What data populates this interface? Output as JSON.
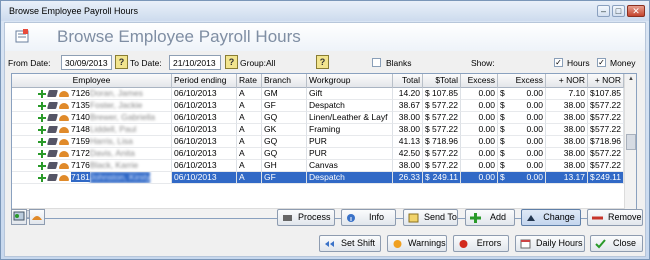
{
  "window": {
    "title": "Browse Employee Payroll Hours",
    "min": "–",
    "max": "□",
    "close": "✕"
  },
  "header": {
    "title": "Browse Employee Payroll Hours"
  },
  "filters": {
    "from_label": "From Date:",
    "from_value": "30/09/2013",
    "to_label": "To Date:",
    "to_value": "21/10/2013",
    "group_label": "Group:All",
    "blanks_label": "Blanks",
    "blanks_checked": false,
    "show_label": "Show:",
    "hours_label": "Hours",
    "hours_checked": true,
    "money_label": "Money",
    "money_checked": true,
    "help": "?"
  },
  "grid": {
    "columns": [
      "Employee",
      "Period ending",
      "Rate",
      "Branch",
      "Workgroup",
      "Total",
      "$Total",
      "Excess",
      "Excess",
      "+ NOR",
      "+ NOR"
    ],
    "rows": [
      {
        "id": "7126",
        "name": "Doran, James",
        "period": "06/10/2013",
        "rate": "A",
        "branch": "GM",
        "workgroup": "Gift",
        "total": "14.20",
        "cur1": "$",
        "stotal": "107.85",
        "excess": "0.00",
        "cur2": "$",
        "excess2": "0.00",
        "nor": "7.10",
        "cur3": "$",
        "nor2": "107.85"
      },
      {
        "id": "7135",
        "name": "Foster, Jackie",
        "period": "06/10/2013",
        "rate": "A",
        "branch": "GF",
        "workgroup": "Despatch",
        "total": "38.67",
        "cur1": "$",
        "stotal": "577.22",
        "excess": "0.00",
        "cur2": "$",
        "excess2": "0.00",
        "nor": "38.00",
        "cur3": "$",
        "nor2": "577.22"
      },
      {
        "id": "7140",
        "name": "Brewer, Gabriella",
        "period": "06/10/2013",
        "rate": "A",
        "branch": "GQ",
        "workgroup": "Linen/Leather & Layf",
        "total": "38.00",
        "cur1": "$",
        "stotal": "577.22",
        "excess": "0.00",
        "cur2": "$",
        "excess2": "0.00",
        "nor": "38.00",
        "cur3": "$",
        "nor2": "577.22"
      },
      {
        "id": "7148",
        "name": "Liddell, Paul",
        "period": "06/10/2013",
        "rate": "A",
        "branch": "GK",
        "workgroup": "Framing",
        "total": "38.00",
        "cur1": "$",
        "stotal": "577.22",
        "excess": "0.00",
        "cur2": "$",
        "excess2": "0.00",
        "nor": "38.00",
        "cur3": "$",
        "nor2": "577.22"
      },
      {
        "id": "7159",
        "name": "Harris, Lisa",
        "period": "06/10/2013",
        "rate": "A",
        "branch": "GQ",
        "workgroup": "PUR",
        "total": "41.13",
        "cur1": "$",
        "stotal": "718.96",
        "excess": "0.00",
        "cur2": "$",
        "excess2": "0.00",
        "nor": "38.00",
        "cur3": "$",
        "nor2": "718.96"
      },
      {
        "id": "7172",
        "name": "Davis, Anita",
        "period": "06/10/2013",
        "rate": "A",
        "branch": "GQ",
        "workgroup": "PUR",
        "total": "42.50",
        "cur1": "$",
        "stotal": "577.22",
        "excess": "0.00",
        "cur2": "$",
        "excess2": "0.00",
        "nor": "38.00",
        "cur3": "$",
        "nor2": "577.22"
      },
      {
        "id": "7176",
        "name": "Black, Karrie",
        "period": "06/10/2013",
        "rate": "A",
        "branch": "GH",
        "workgroup": "Canvas",
        "total": "38.00",
        "cur1": "$",
        "stotal": "577.22",
        "excess": "0.00",
        "cur2": "$",
        "excess2": "0.00",
        "nor": "38.00",
        "cur3": "$",
        "nor2": "577.22"
      },
      {
        "id": "7181",
        "name": "Johnston, Kirsty",
        "period": "06/10/2013",
        "rate": "A",
        "branch": "GF",
        "workgroup": "Despatch",
        "total": "26.33",
        "cur1": "$",
        "stotal": "249.11",
        "excess": "0.00",
        "cur2": "$",
        "excess2": "0.00",
        "nor": "13.17",
        "cur3": "$",
        "nor2": "249.11",
        "selected": true
      }
    ]
  },
  "actions": {
    "process": "Process",
    "info": "Info",
    "send_to": "Send To",
    "add": "Add",
    "change": "Change",
    "remove": "Remove"
  },
  "footer": {
    "set_shift": "Set Shift",
    "warnings": "Warnings",
    "errors": "Errors",
    "daily_hours": "Daily Hours",
    "close": "Close"
  }
}
